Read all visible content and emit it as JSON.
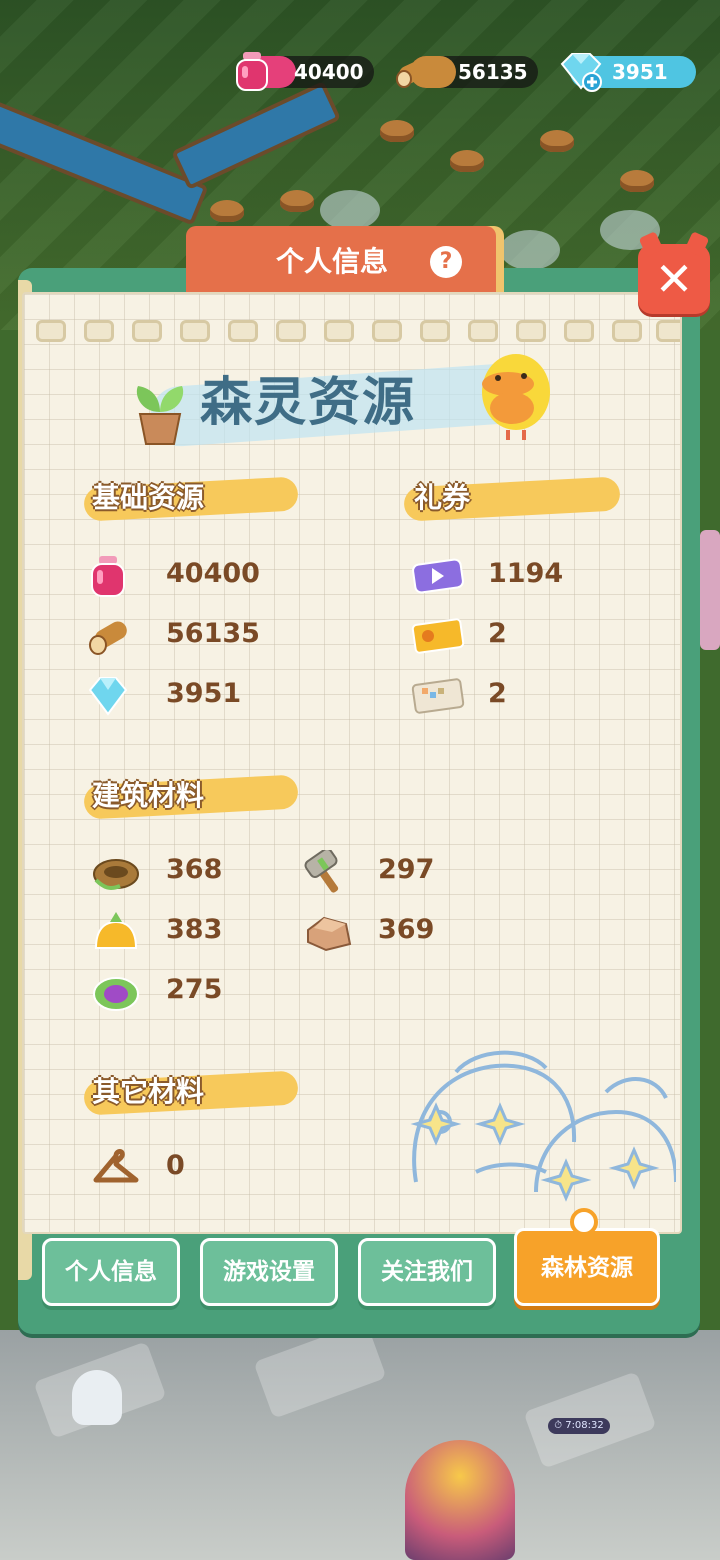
{
  "topbar": {
    "ink": "40400",
    "wood": "56135",
    "gems": "3951"
  },
  "panel": {
    "tab_title": "个人信息",
    "help_glyph": "?",
    "close_glyph": "✕",
    "heading": "森灵资源"
  },
  "sections": {
    "basic": {
      "label": "基础资源",
      "items": [
        {
          "icon": "ink-bottle-icon",
          "value": "40400"
        },
        {
          "icon": "wood-log-icon",
          "value": "56135"
        },
        {
          "icon": "gem-icon",
          "value": "3951"
        }
      ]
    },
    "vouchers": {
      "label": "礼券",
      "items": [
        {
          "icon": "video-ticket-icon",
          "value": "1194"
        },
        {
          "icon": "gold-ticket-icon",
          "value": "2"
        },
        {
          "icon": "paper-ticket-icon",
          "value": "2"
        }
      ]
    },
    "building": {
      "label": "建筑材料",
      "items": [
        {
          "icon": "rope-coil-icon",
          "value": "368"
        },
        {
          "icon": "hammer-icon",
          "value": "297"
        },
        {
          "icon": "orange-sack-icon",
          "value": "383"
        },
        {
          "icon": "stone-block-icon",
          "value": "369"
        },
        {
          "icon": "purple-leaf-bundle-icon",
          "value": "275"
        }
      ]
    },
    "other": {
      "label": "其它材料",
      "items": [
        {
          "icon": "hanger-icon",
          "value": "0"
        }
      ]
    }
  },
  "tabs": [
    {
      "label": "个人信息",
      "active": false
    },
    {
      "label": "游戏设置",
      "active": false
    },
    {
      "label": "关注我们",
      "active": false
    },
    {
      "label": "森林资源",
      "active": true
    }
  ],
  "world": {
    "timer": "7:08:32"
  },
  "colors": {
    "accent_orange": "#f7a229",
    "panel_green": "#4aa07a",
    "value_brown": "#7a4a26",
    "title_tab": "#e5704a"
  }
}
